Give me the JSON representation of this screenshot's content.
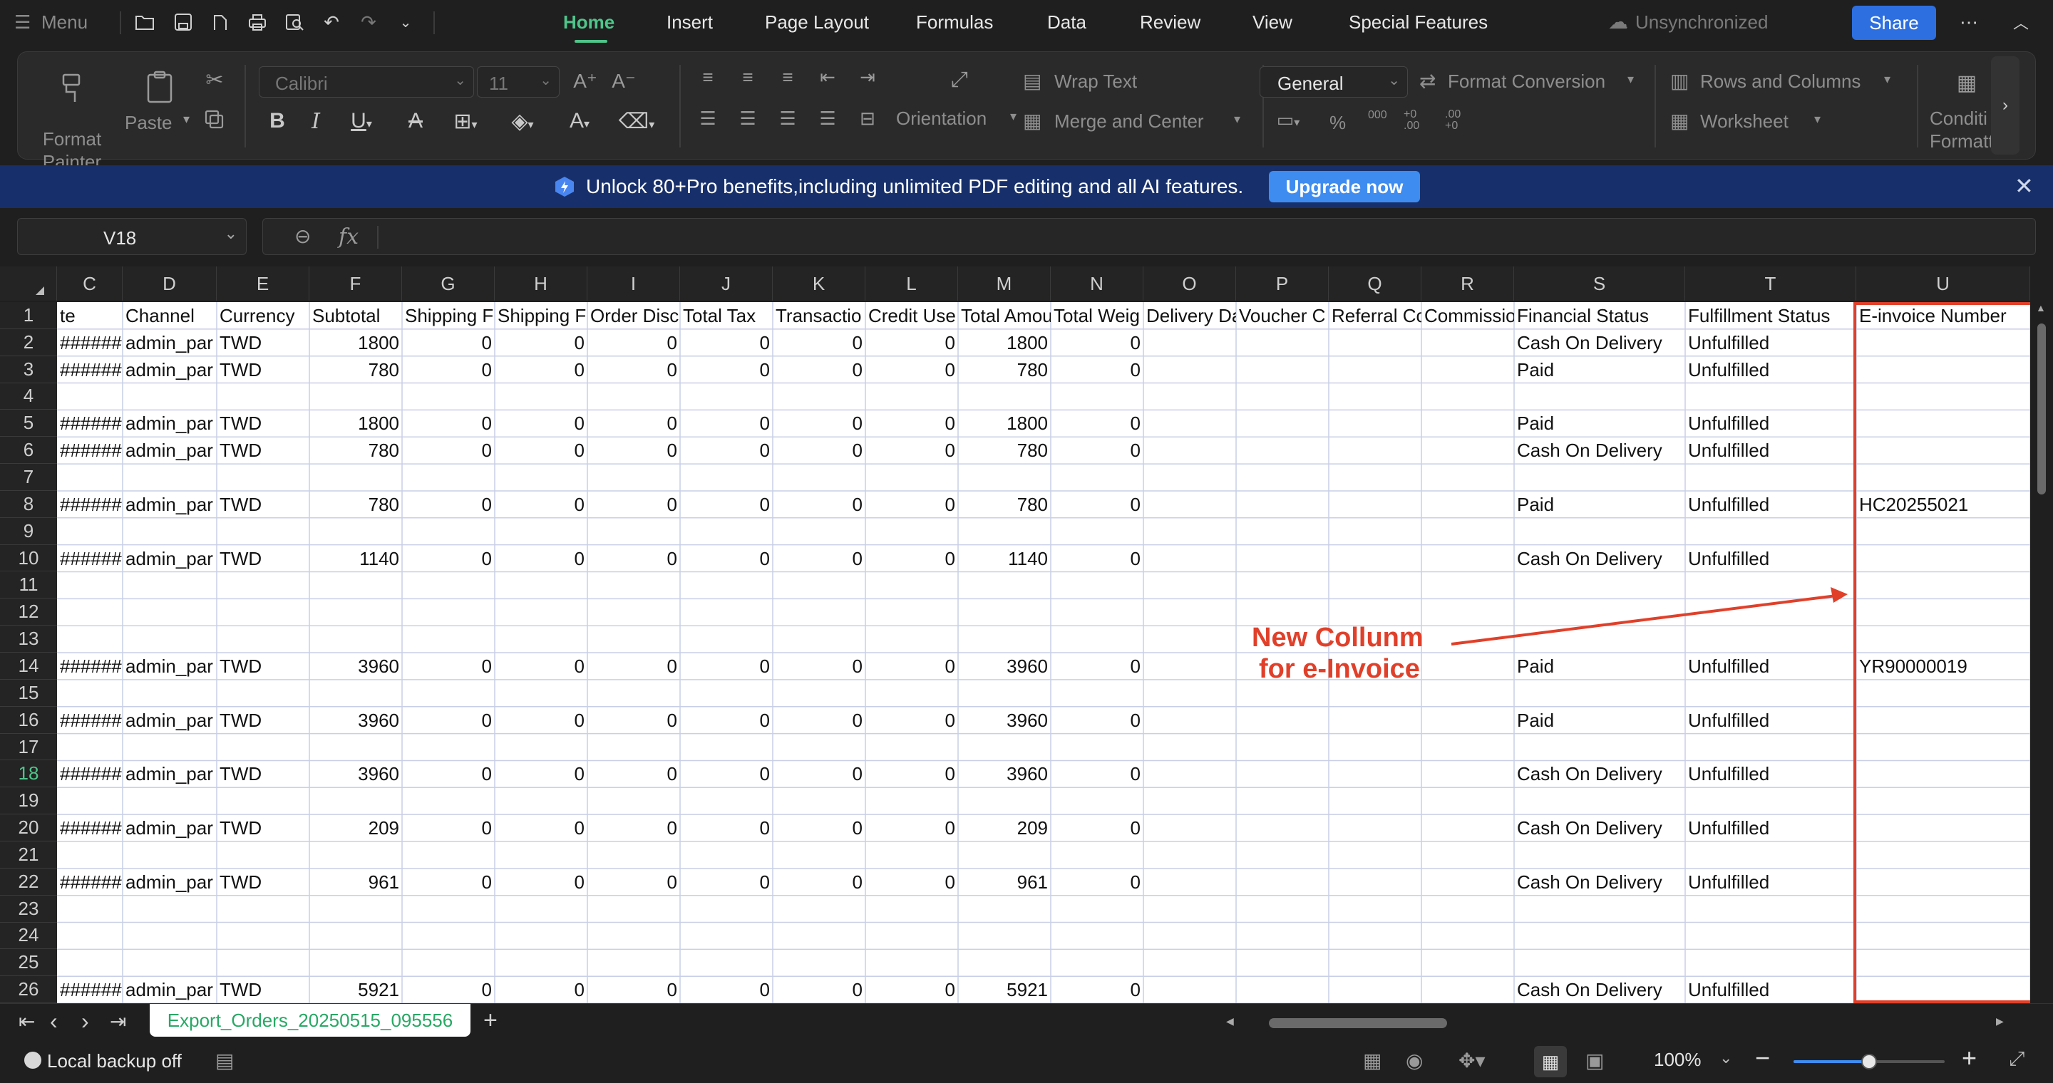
{
  "menubar": {
    "menu_label": "Menu",
    "tabs": [
      "Home",
      "Insert",
      "Page Layout",
      "Formulas",
      "Data",
      "Review",
      "View",
      "Special Features"
    ],
    "sync_status": "Unsynchronized",
    "share_label": "Share"
  },
  "ribbon": {
    "format_painter": "Format Painter",
    "paste": "Paste",
    "font_name": "Calibri",
    "font_size": "11",
    "orientation": "Orientation",
    "wrap_text": "Wrap Text",
    "merge_center": "Merge and Center",
    "number_format": "General",
    "format_conversion": "Format Conversion",
    "rows_columns": "Rows and  Columns",
    "worksheet": "Worksheet",
    "conditional_a": "Conditi",
    "conditional_b": "Formatt",
    "percent": "%",
    "thousands": "000",
    "dec_inc": "+0 .00",
    "dec_dec": ".00 +0"
  },
  "promo": {
    "text": "Unlock 80+Pro benefits,including unlimited PDF editing and all AI features.",
    "button": "Upgrade now"
  },
  "formula_bar": {
    "name_box": "V18",
    "fx": "fx"
  },
  "columns": [
    "C",
    "D",
    "E",
    "F",
    "G",
    "H",
    "I",
    "J",
    "K",
    "L",
    "M",
    "N",
    "O",
    "P",
    "Q",
    "R",
    "S",
    "T",
    "U"
  ],
  "header_row": [
    "te",
    "Channel",
    "Currency",
    "Subtotal",
    "Shipping F",
    "Shipping F",
    "Order Disc",
    "Total Tax",
    "Transactio",
    "Credit Use",
    "Total Amou",
    "Total Weig",
    "Delivery Da",
    "Voucher C",
    "Referral Co",
    "Commissio",
    "Financial Status",
    "Fulfillment Status",
    "E-invoice Number"
  ],
  "rows": [
    {
      "n": "1",
      "cells": []
    },
    {
      "n": "2",
      "cells": [
        "######",
        "admin_par",
        "TWD",
        "1800",
        "0",
        "0",
        "0",
        "0",
        "0",
        "0",
        "1800",
        "0",
        "",
        "",
        "",
        "",
        "Cash On Delivery",
        "Unfulfilled",
        ""
      ]
    },
    {
      "n": "3",
      "cells": [
        "######",
        "admin_par",
        "TWD",
        "780",
        "0",
        "0",
        "0",
        "0",
        "0",
        "0",
        "780",
        "0",
        "",
        "",
        "",
        "",
        "Paid",
        "Unfulfilled",
        ""
      ]
    },
    {
      "n": "4",
      "cells": []
    },
    {
      "n": "5",
      "cells": [
        "######",
        "admin_par",
        "TWD",
        "1800",
        "0",
        "0",
        "0",
        "0",
        "0",
        "0",
        "1800",
        "0",
        "",
        "",
        "",
        "",
        "Paid",
        "Unfulfilled",
        ""
      ]
    },
    {
      "n": "6",
      "cells": [
        "######",
        "admin_par",
        "TWD",
        "780",
        "0",
        "0",
        "0",
        "0",
        "0",
        "0",
        "780",
        "0",
        "",
        "",
        "",
        "",
        "Cash On Delivery",
        "Unfulfilled",
        ""
      ]
    },
    {
      "n": "7",
      "cells": []
    },
    {
      "n": "8",
      "cells": [
        "######",
        "admin_par",
        "TWD",
        "780",
        "0",
        "0",
        "0",
        "0",
        "0",
        "0",
        "780",
        "0",
        "",
        "",
        "",
        "",
        "Paid",
        "Unfulfilled",
        "HC20255021"
      ]
    },
    {
      "n": "9",
      "cells": []
    },
    {
      "n": "10",
      "cells": [
        "######",
        "admin_par",
        "TWD",
        "1140",
        "0",
        "0",
        "0",
        "0",
        "0",
        "0",
        "1140",
        "0",
        "",
        "",
        "",
        "",
        "Cash On Delivery",
        "Unfulfilled",
        ""
      ]
    },
    {
      "n": "11",
      "cells": []
    },
    {
      "n": "12",
      "cells": []
    },
    {
      "n": "13",
      "cells": []
    },
    {
      "n": "14",
      "cells": [
        "######",
        "admin_par",
        "TWD",
        "3960",
        "0",
        "0",
        "0",
        "0",
        "0",
        "0",
        "3960",
        "0",
        "",
        "",
        "",
        "",
        "Paid",
        "Unfulfilled",
        "YR90000019"
      ]
    },
    {
      "n": "15",
      "cells": []
    },
    {
      "n": "16",
      "cells": [
        "######",
        "admin_par",
        "TWD",
        "3960",
        "0",
        "0",
        "0",
        "0",
        "0",
        "0",
        "3960",
        "0",
        "",
        "",
        "",
        "",
        "Paid",
        "Unfulfilled",
        ""
      ]
    },
    {
      "n": "17",
      "cells": []
    },
    {
      "n": "18",
      "cells": [
        "######",
        "admin_par",
        "TWD",
        "3960",
        "0",
        "0",
        "0",
        "0",
        "0",
        "0",
        "3960",
        "0",
        "",
        "",
        "",
        "",
        "Cash On Delivery",
        "Unfulfilled",
        ""
      ]
    },
    {
      "n": "19",
      "cells": []
    },
    {
      "n": "20",
      "cells": [
        "######",
        "admin_par",
        "TWD",
        "209",
        "0",
        "0",
        "0",
        "0",
        "0",
        "0",
        "209",
        "0",
        "",
        "",
        "",
        "",
        "Cash On Delivery",
        "Unfulfilled",
        ""
      ]
    },
    {
      "n": "21",
      "cells": []
    },
    {
      "n": "22",
      "cells": [
        "######",
        "admin_par",
        "TWD",
        "961",
        "0",
        "0",
        "0",
        "0",
        "0",
        "0",
        "961",
        "0",
        "",
        "",
        "",
        "",
        "Cash On Delivery",
        "Unfulfilled",
        ""
      ]
    },
    {
      "n": "23",
      "cells": []
    },
    {
      "n": "24",
      "cells": []
    },
    {
      "n": "25",
      "cells": []
    },
    {
      "n": "26",
      "cells": [
        "######",
        "admin_par",
        "TWD",
        "5921",
        "0",
        "0",
        "0",
        "0",
        "0",
        "0",
        "5921",
        "0",
        "",
        "",
        "",
        "",
        "Cash On Delivery",
        "Unfulfilled",
        ""
      ]
    }
  ],
  "annotation": {
    "line1": "New Collunm",
    "line2": "for e-Invoice",
    "color": "#e0402a"
  },
  "sheet_tab": "Export_Orders_20250515_095556",
  "status": {
    "backup": "Local backup off",
    "zoom": "100%",
    "zoom_level": 0.5
  },
  "colors": {
    "accent": "#4fc58a",
    "share": "#2d6fe0",
    "promo_bg": "#17306b",
    "upgrade": "#3f8cf0"
  }
}
